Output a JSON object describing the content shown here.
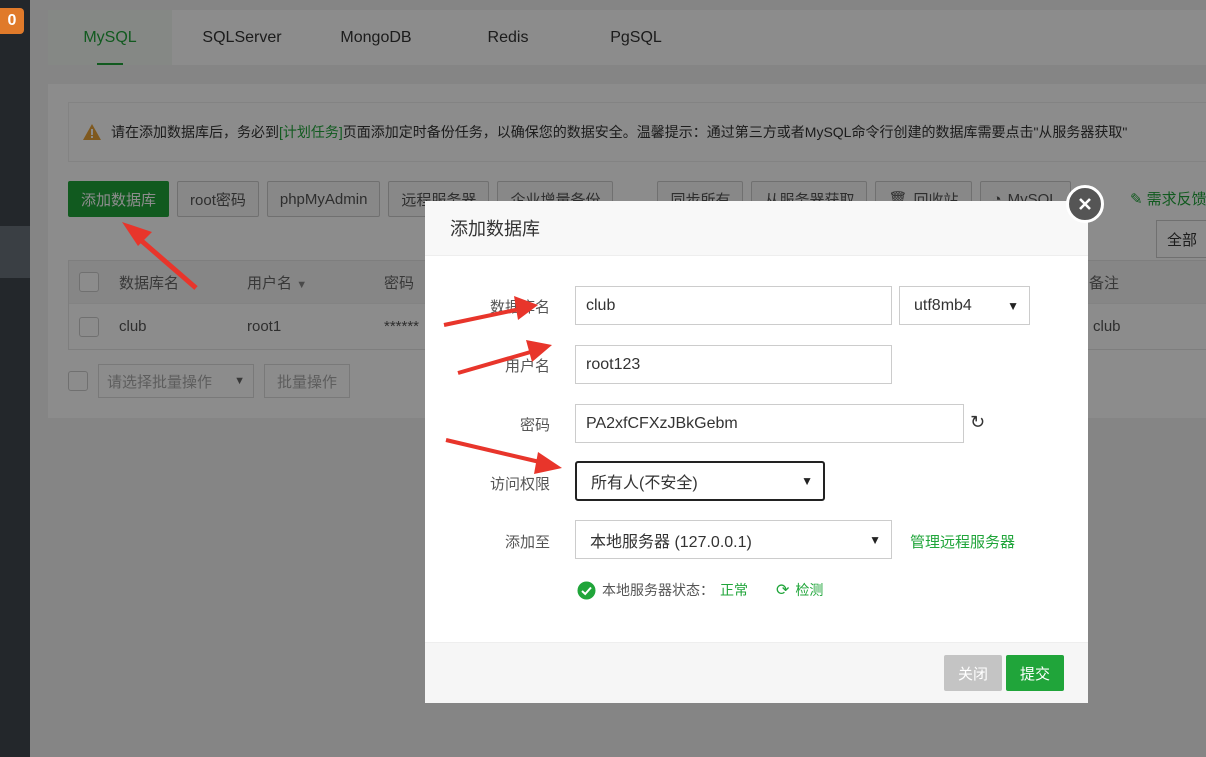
{
  "sidebar": {
    "badge": "0"
  },
  "tabs": [
    "MySQL",
    "SQLServer",
    "MongoDB",
    "Redis",
    "PgSQL"
  ],
  "notice": {
    "before": "请在添加数据库后，务必到",
    "link": "[计划任务]",
    "after": "页面添加定时备份任务，以确保您的数据安全。温馨提示：通过第三方或者MySQL命令行创建的数据库需要点击\"从服务器获取\""
  },
  "toolbar": {
    "buttons": [
      "添加数据库",
      "root密码",
      "phpMyAdmin",
      "远程服务器",
      "企业增量备份",
      "同步所有",
      "从服务器获取",
      "回收站",
      "MySQL"
    ],
    "feedback": "需求反馈",
    "all": "全部"
  },
  "table": {
    "headers": {
      "name": "数据库名",
      "user": "用户名",
      "password": "密码",
      "note": "备注"
    },
    "row": {
      "name": "club",
      "user": "root1",
      "password": "******",
      "note": "club"
    }
  },
  "batch": {
    "select_placeholder": "请选择批量操作",
    "button": "批量操作"
  },
  "modal": {
    "title": "添加数据库",
    "fields": {
      "db_name_label": "数据库名",
      "db_name_value": "club",
      "charset": "utf8mb4",
      "user_label": "用户名",
      "user_value": "root123",
      "password_label": "密码",
      "password_value": "PA2xfCFXzJBkGebm",
      "access_label": "访问权限",
      "access_value": "所有人(不安全)",
      "add_to_label": "添加至",
      "add_to_value": "本地服务器 (127.0.0.1)",
      "manage_remote": "管理远程服务器"
    },
    "status": {
      "label": "本地服务器状态：",
      "value": "正常",
      "check": "检测"
    },
    "buttons": {
      "close": "关闭",
      "submit": "提交"
    }
  },
  "colors": {
    "accent": "#20a53a",
    "arrow": "#e8352b"
  }
}
